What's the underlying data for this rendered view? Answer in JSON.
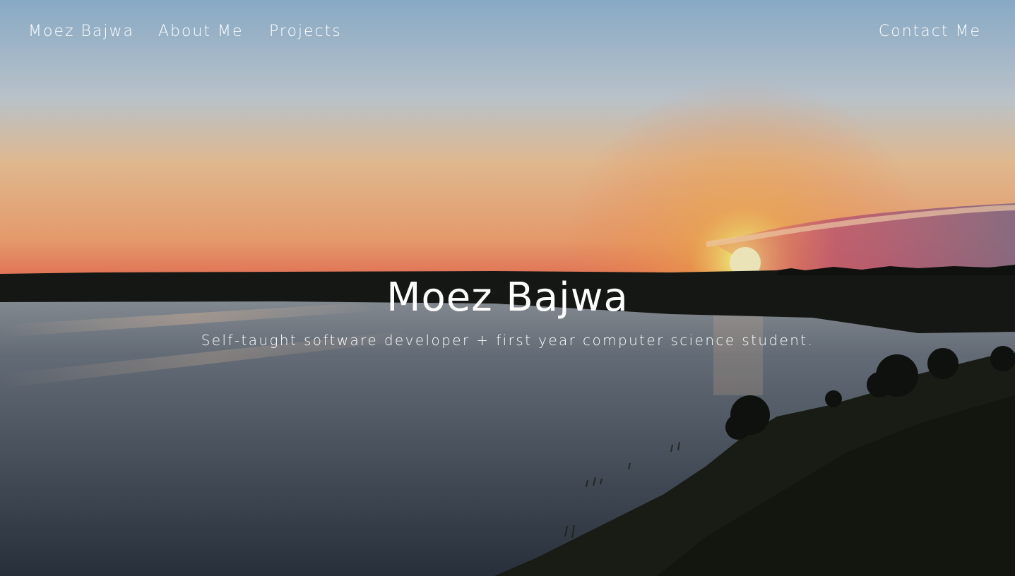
{
  "nav": {
    "brand": "Moez Bajwa",
    "about": "About Me",
    "projects": "Projects",
    "contact": "Contact Me"
  },
  "hero": {
    "title": "Moez Bajwa",
    "subtitle": "Self-taught software developer + first year computer science student.",
    "background": "sunset-over-lake-photo"
  },
  "colors": {
    "nav_text": "#ffffff",
    "hero_text": "#ffffff",
    "sky_top": "#93b8d6",
    "sky_horizon": "#f58a5a",
    "water": "#4a5563",
    "treeline": "#161a16",
    "sun": "#fff2a0"
  }
}
